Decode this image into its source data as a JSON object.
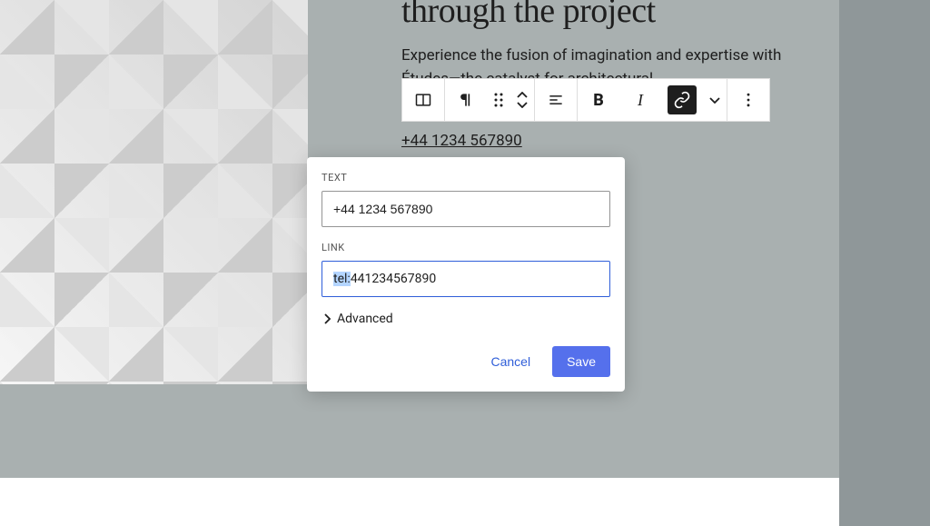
{
  "heading": "through the project",
  "subtext": "Experience the fusion of imagination and expertise with Études—the catalyst for architectural",
  "phone_link_text": "+44 1234 567890",
  "toolbar": {
    "icons": {
      "column": "column-icon",
      "paragraph": "paragraph-icon",
      "drag": "drag-handle-icon",
      "move_up": "chevron-up-icon",
      "move_down": "chevron-down-icon",
      "align": "align-left-icon",
      "bold": "B",
      "italic": "I",
      "link": "link-icon",
      "more_chevron": "chevron-down-icon",
      "more": "more-icon"
    }
  },
  "popover": {
    "text_label": "TEXT",
    "text_value": "+44 1234 567890",
    "link_label": "LINK",
    "link_prefix": "tel:",
    "link_rest": "441234567890",
    "advanced_label": "Advanced",
    "cancel_label": "Cancel",
    "save_label": "Save"
  }
}
